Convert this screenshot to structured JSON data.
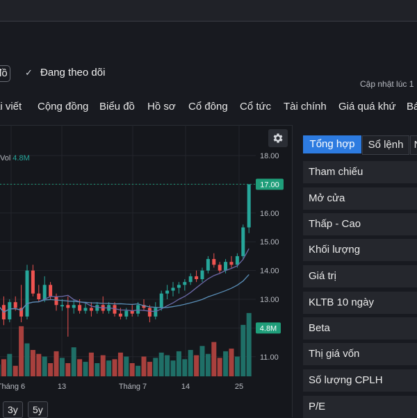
{
  "header": {
    "prev_label": "đồ",
    "follow_label": "Đang theo dõi",
    "updated_label": "Cập nhật lúc  1"
  },
  "nav": {
    "tabs": [
      "ài viết",
      "Cộng đồng",
      "Biểu đồ",
      "Hồ sơ",
      "Cổ đông",
      "Cổ tức",
      "Tài chính",
      "Giá quá khứ",
      "Bá"
    ]
  },
  "chart": {
    "vol_label": "Vol",
    "vol_value": "4.8M",
    "icon": "gear-icon",
    "colors": {
      "up": "#26a69a",
      "down": "#ef5350",
      "ma1": "#6c6aa8",
      "ma2": "#5a8fb8",
      "price_tag": "#1f9e7a"
    }
  },
  "chart_data": {
    "type": "candlestick",
    "y_ticks": [
      "18.00",
      "17.00",
      "16.00",
      "15.00",
      "14.00",
      "13.00",
      "12.00",
      "11.00"
    ],
    "x_ticks": [
      "Tháng 6",
      "13",
      "Tháng 7",
      "14",
      "25"
    ],
    "last_price_label": "17.00",
    "volume_label": "4.8M",
    "candles": [
      {
        "o": 12.7,
        "h": 13.0,
        "l": 12.5,
        "c": 12.8,
        "v": 0.9
      },
      {
        "o": 12.8,
        "h": 13.1,
        "l": 12.1,
        "c": 12.3,
        "v": 1.3
      },
      {
        "o": 12.3,
        "h": 13.0,
        "l": 12.2,
        "c": 12.9,
        "v": 1.7
      },
      {
        "o": 12.9,
        "h": 13.1,
        "l": 12.6,
        "c": 12.7,
        "v": 0.8
      },
      {
        "o": 12.7,
        "h": 13.5,
        "l": 12.2,
        "c": 12.4,
        "v": 3.8
      },
      {
        "o": 12.4,
        "h": 14.2,
        "l": 12.3,
        "c": 14.0,
        "v": 2.5
      },
      {
        "o": 14.0,
        "h": 14.2,
        "l": 13.1,
        "c": 13.2,
        "v": 2.0
      },
      {
        "o": 13.2,
        "h": 13.5,
        "l": 12.9,
        "c": 13.0,
        "v": 1.7
      },
      {
        "o": 13.0,
        "h": 13.8,
        "l": 12.9,
        "c": 13.5,
        "v": 1.5
      },
      {
        "o": 13.5,
        "h": 13.6,
        "l": 13.0,
        "c": 13.1,
        "v": 1.0
      },
      {
        "o": 13.1,
        "h": 13.2,
        "l": 12.6,
        "c": 12.8,
        "v": 1.9
      },
      {
        "o": 12.8,
        "h": 13.0,
        "l": 12.6,
        "c": 12.8,
        "v": 1.4
      },
      {
        "o": 12.8,
        "h": 13.1,
        "l": 11.7,
        "c": 12.7,
        "v": 1.0
      },
      {
        "o": 12.7,
        "h": 13.0,
        "l": 12.5,
        "c": 12.8,
        "v": 2.2
      },
      {
        "o": 12.8,
        "h": 13.0,
        "l": 12.5,
        "c": 12.6,
        "v": 1.3
      },
      {
        "o": 12.6,
        "h": 12.9,
        "l": 12.5,
        "c": 12.7,
        "v": 1.1
      },
      {
        "o": 12.7,
        "h": 12.9,
        "l": 12.4,
        "c": 12.6,
        "v": 1.8
      },
      {
        "o": 12.6,
        "h": 12.9,
        "l": 12.5,
        "c": 12.8,
        "v": 1.0
      },
      {
        "o": 12.8,
        "h": 13.1,
        "l": 12.5,
        "c": 12.6,
        "v": 1.6
      },
      {
        "o": 12.6,
        "h": 12.9,
        "l": 12.5,
        "c": 12.8,
        "v": 1.2
      },
      {
        "o": 12.8,
        "h": 12.9,
        "l": 12.4,
        "c": 12.5,
        "v": 1.3
      },
      {
        "o": 12.5,
        "h": 12.7,
        "l": 12.3,
        "c": 12.4,
        "v": 1.8
      },
      {
        "o": 12.4,
        "h": 12.7,
        "l": 12.3,
        "c": 12.6,
        "v": 1.5
      },
      {
        "o": 12.6,
        "h": 12.8,
        "l": 12.4,
        "c": 12.5,
        "v": 1.0
      },
      {
        "o": 12.5,
        "h": 12.9,
        "l": 12.4,
        "c": 12.8,
        "v": 0.8
      },
      {
        "o": 12.8,
        "h": 13.0,
        "l": 12.6,
        "c": 12.7,
        "v": 1.5
      },
      {
        "o": 12.7,
        "h": 12.8,
        "l": 12.2,
        "c": 12.4,
        "v": 1.1
      },
      {
        "o": 12.4,
        "h": 12.9,
        "l": 12.3,
        "c": 12.7,
        "v": 1.4
      },
      {
        "o": 12.7,
        "h": 13.3,
        "l": 12.6,
        "c": 13.2,
        "v": 1.8
      },
      {
        "o": 13.2,
        "h": 13.5,
        "l": 13.0,
        "c": 13.3,
        "v": 1.6
      },
      {
        "o": 13.3,
        "h": 13.6,
        "l": 13.1,
        "c": 13.4,
        "v": 1.2
      },
      {
        "o": 13.4,
        "h": 13.6,
        "l": 13.2,
        "c": 13.5,
        "v": 1.9
      },
      {
        "o": 13.5,
        "h": 13.7,
        "l": 13.3,
        "c": 13.6,
        "v": 1.3
      },
      {
        "o": 13.6,
        "h": 13.9,
        "l": 13.5,
        "c": 13.8,
        "v": 2.0
      },
      {
        "o": 13.8,
        "h": 14.0,
        "l": 13.6,
        "c": 13.7,
        "v": 1.6
      },
      {
        "o": 13.7,
        "h": 14.1,
        "l": 13.6,
        "c": 14.0,
        "v": 2.3
      },
      {
        "o": 14.0,
        "h": 14.5,
        "l": 13.9,
        "c": 14.4,
        "v": 1.7
      },
      {
        "o": 14.4,
        "h": 14.6,
        "l": 14.1,
        "c": 14.2,
        "v": 2.6
      },
      {
        "o": 14.2,
        "h": 14.3,
        "l": 13.9,
        "c": 14.0,
        "v": 1.4
      },
      {
        "o": 14.0,
        "h": 14.4,
        "l": 13.9,
        "c": 14.3,
        "v": 1.9
      },
      {
        "o": 14.3,
        "h": 14.5,
        "l": 14.1,
        "c": 14.2,
        "v": 2.1
      },
      {
        "o": 14.2,
        "h": 14.6,
        "l": 14.1,
        "c": 14.5,
        "v": 1.5
      },
      {
        "o": 14.5,
        "h": 15.6,
        "l": 14.4,
        "c": 15.5,
        "v": 3.9
      },
      {
        "o": 15.5,
        "h": 17.0,
        "l": 15.3,
        "c": 17.0,
        "v": 4.8
      }
    ]
  },
  "ranges": [
    "3y",
    "5y"
  ],
  "side_tabs": [
    "Tổng hợp",
    "Sổ lệnh",
    "N"
  ],
  "stats": [
    "Tham chiếu",
    "Mở cửa",
    "Thấp - Cao",
    "Khối lượng",
    "Giá trị",
    "KLTB 10 ngày",
    "Beta",
    "Thị giá vốn",
    "Số lượng CPLH",
    "P/E"
  ]
}
